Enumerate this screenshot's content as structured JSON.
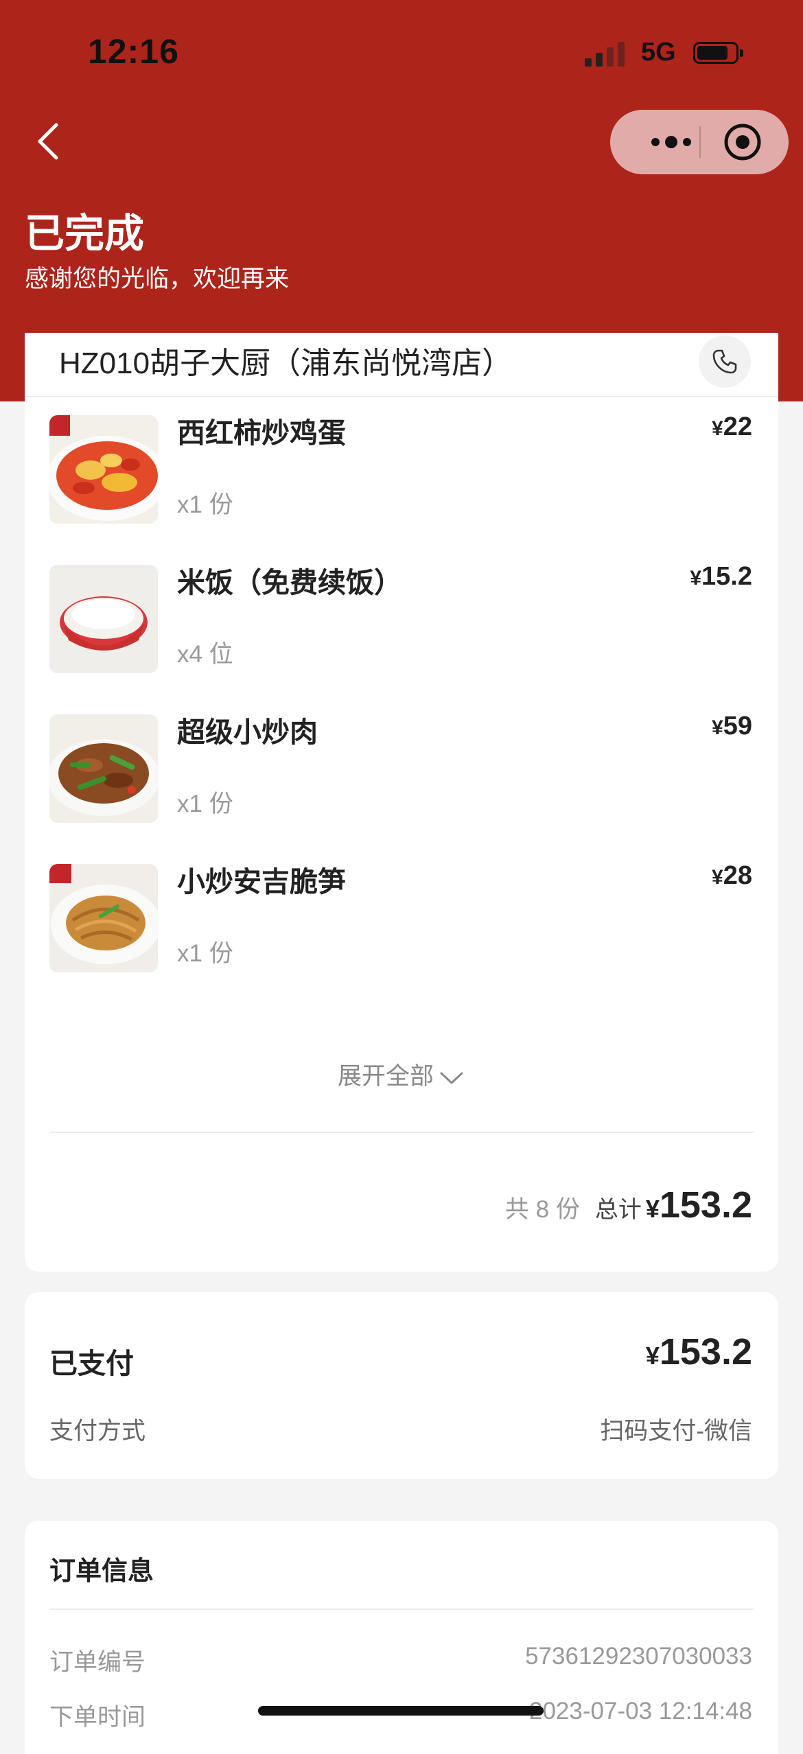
{
  "status_bar": {
    "time": "12:16",
    "network": "5G"
  },
  "header": {
    "title": "已完成",
    "subtitle": "感谢您的光临，欢迎再来",
    "colors": {
      "background": "#ad241b"
    }
  },
  "order": {
    "shop_name": "HZ010胡子大厨（浦东尚悦湾店）",
    "items": [
      {
        "name": "西红柿炒鸡蛋",
        "qty": "x1 份",
        "currency": "¥",
        "price": "22",
        "image": "tomato-egg-dish"
      },
      {
        "name": "米饭（免费续饭）",
        "qty": "x4 位",
        "currency": "¥",
        "price": "15.2",
        "image": "rice-bowl"
      },
      {
        "name": "超级小炒肉",
        "qty": "x1 份",
        "currency": "¥",
        "price": "59",
        "image": "stir-fried-pork-dish"
      },
      {
        "name": "小炒安吉脆笋",
        "qty": "x1 份",
        "currency": "¥",
        "price": "28",
        "image": "bamboo-shoot-dish"
      }
    ],
    "expand_label": "展开全部",
    "count_label": "共 8 份",
    "total_label": "总计",
    "total_currency": "¥",
    "total_amount": "153.2"
  },
  "payment": {
    "paid_label": "已支付",
    "currency": "¥",
    "amount": "153.2",
    "method_label": "支付方式",
    "method_value": "扫码支付-微信"
  },
  "order_info": {
    "title": "订单信息",
    "rows": [
      {
        "label": "订单编号",
        "value": "57361292307030033"
      },
      {
        "label": "下单时间",
        "value": "2023-07-03 12:14:48"
      }
    ]
  }
}
